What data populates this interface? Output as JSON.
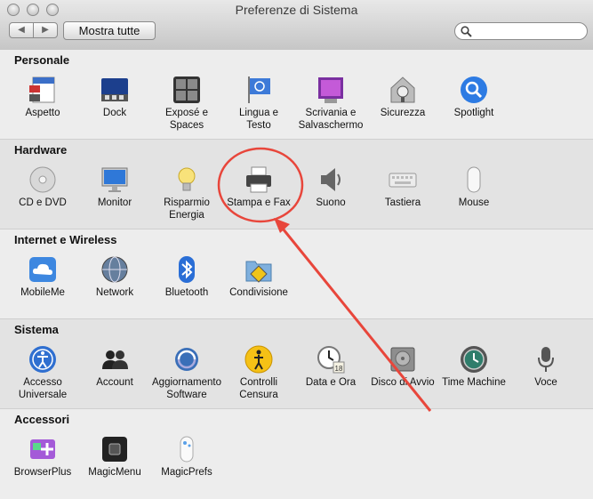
{
  "window": {
    "title": "Preferenze di Sistema"
  },
  "toolbar": {
    "back": "◀",
    "forward": "▶",
    "show_all": "Mostra tutte",
    "search_placeholder": ""
  },
  "sections": [
    {
      "title": "Personale",
      "items": [
        {
          "label": "Aspetto",
          "icon": "appearance-icon"
        },
        {
          "label": "Dock",
          "icon": "dock-icon"
        },
        {
          "label": "Exposé e\nSpaces",
          "icon": "expose-icon"
        },
        {
          "label": "Lingua e\nTesto",
          "icon": "language-icon"
        },
        {
          "label": "Scrivania e\nSalvaschermo",
          "icon": "desktop-icon"
        },
        {
          "label": "Sicurezza",
          "icon": "security-icon"
        },
        {
          "label": "Spotlight",
          "icon": "spotlight-icon"
        }
      ]
    },
    {
      "title": "Hardware",
      "items": [
        {
          "label": "CD e DVD",
          "icon": "cd-icon"
        },
        {
          "label": "Monitor",
          "icon": "monitor-icon"
        },
        {
          "label": "Risparmio\nEnergia",
          "icon": "lightbulb-icon"
        },
        {
          "label": "Stampa e Fax",
          "icon": "printer-icon"
        },
        {
          "label": "Suono",
          "icon": "speaker-icon"
        },
        {
          "label": "Tastiera",
          "icon": "keyboard-icon"
        },
        {
          "label": "Mouse",
          "icon": "mouse-icon"
        }
      ]
    },
    {
      "title": "Internet e Wireless",
      "items": [
        {
          "label": "MobileMe",
          "icon": "cloud-icon"
        },
        {
          "label": "Network",
          "icon": "globe-icon"
        },
        {
          "label": "Bluetooth",
          "icon": "bluetooth-icon"
        },
        {
          "label": "Condivisione",
          "icon": "sharing-icon"
        }
      ]
    },
    {
      "title": "Sistema",
      "items": [
        {
          "label": "Accesso\nUniversale",
          "icon": "accessibility-icon"
        },
        {
          "label": "Account",
          "icon": "accounts-icon"
        },
        {
          "label": "Aggiornamento\nSoftware",
          "icon": "update-icon"
        },
        {
          "label": "Controlli\nCensura",
          "icon": "parental-icon"
        },
        {
          "label": "Data e Ora",
          "icon": "clock-icon"
        },
        {
          "label": "Disco di Avvio",
          "icon": "disk-icon"
        },
        {
          "label": "Time Machine",
          "icon": "timemachine-icon"
        },
        {
          "label": "Voce",
          "icon": "microphone-icon"
        }
      ]
    },
    {
      "title": "Accessori",
      "items": [
        {
          "label": "BrowserPlus",
          "icon": "browserplus-icon"
        },
        {
          "label": "MagicMenu",
          "icon": "magicmenu-icon"
        },
        {
          "label": "MagicPrefs",
          "icon": "magicprefs-icon"
        }
      ]
    }
  ],
  "annotation": {
    "color": "#e8463b"
  }
}
